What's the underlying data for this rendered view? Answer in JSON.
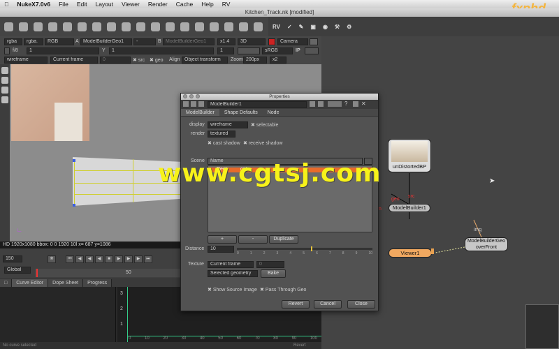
{
  "menubar": {
    "app_name": "NukeX7.0v6",
    "items": [
      "File",
      "Edit",
      "Layout",
      "Viewer",
      "Render",
      "Cache",
      "Help",
      "RV"
    ]
  },
  "window": {
    "title": "Kitchen_Track.nk [modified]"
  },
  "watermark_logo": "fxphd",
  "dag_toolbar": {
    "rv_label": "RV"
  },
  "viewer_controls": {
    "channels_a": "rgba",
    "channels_b": "rgba.",
    "colorspace_sel": "RGB",
    "input_a_label": "A",
    "input_a": "ModelBuilderGeo1",
    "dash": "-",
    "input_b_label": "B",
    "input_b": "ModelBuilderGeo1",
    "zoom": "x1.4",
    "view_mode": "3D",
    "camera": "Camera",
    "gain_label": "f/8",
    "gain_value": "1",
    "gamma_label": "Y",
    "gamma_value": "1",
    "lut": "sRGB",
    "proxy": "1",
    "ip_label": "IP",
    "display_mode": "wireframe",
    "frame_mode": "Current frame",
    "frame_value": "0",
    "src_label": "src",
    "geo_label": "geo",
    "align_label": "Align",
    "align_value": "Object transform",
    "zoom_label": "Zoom",
    "zoom_value": "200px",
    "zoom_mult": "x2"
  },
  "viewer_info": "HD 1920x1080 bbox: 0 0 1920 10l  x= 687 y=1086",
  "timeline": {
    "frame": "150",
    "range_mode": "Global",
    "tick_50": "50"
  },
  "bottom_tabs": [
    "Curve Editor",
    "Dope Sheet",
    "Progress"
  ],
  "curve_y_ticks": [
    "3",
    "2",
    "1"
  ],
  "curve_x_ticks": [
    "0",
    "10",
    "20",
    "30",
    "40",
    "50",
    "60",
    "70",
    "80",
    "90",
    "100"
  ],
  "status": {
    "left": "No curve selected",
    "revert": "Revert"
  },
  "dag": {
    "nodes": {
      "undistorted": "unDistortedBP",
      "modelbuilder": "ModelBuilder1",
      "modelbuildergeo": "ModelBuilderGeo\noverFront",
      "viewer": "Viewer1"
    },
    "pipe_labels": {
      "geo": "geo",
      "src": "src",
      "img": "img",
      "m": "m"
    }
  },
  "properties": {
    "title": "Properties",
    "node_name": "ModelBuilder1",
    "tabs": [
      "ModelBuilder",
      "Shape Defaults",
      "Node"
    ],
    "display_label": "display",
    "display_value": "wireframe",
    "selectable": "selectable",
    "render_label": "render",
    "render_value": "textured",
    "cast_shadow": "cast shadow",
    "receive_shadow": "receive shadow",
    "scene_label": "Scene",
    "scene_col": "Name",
    "scene_rows": [
      "Rect"
    ],
    "scene_row_suffix": "ont",
    "plus": "+",
    "minus": "-",
    "duplicate": "Duplicate",
    "distance_label": "Distance",
    "distance_value": "10",
    "distance_ticks": [
      "0",
      "1",
      "2",
      "3",
      "4",
      "5",
      "6",
      "7",
      "8",
      "9",
      "10"
    ],
    "texture_label": "Texture",
    "texture_mode": "Current frame",
    "texture_frame": "0",
    "selected_geometry": "Selected geometry",
    "bake": "Bake",
    "show_source_image": "Show Source Image",
    "pass_through_geo": "Pass Through Geo",
    "revert": "Revert",
    "cancel": "Cancel",
    "close": "Close"
  },
  "watermark": "www.cgtsj.com"
}
